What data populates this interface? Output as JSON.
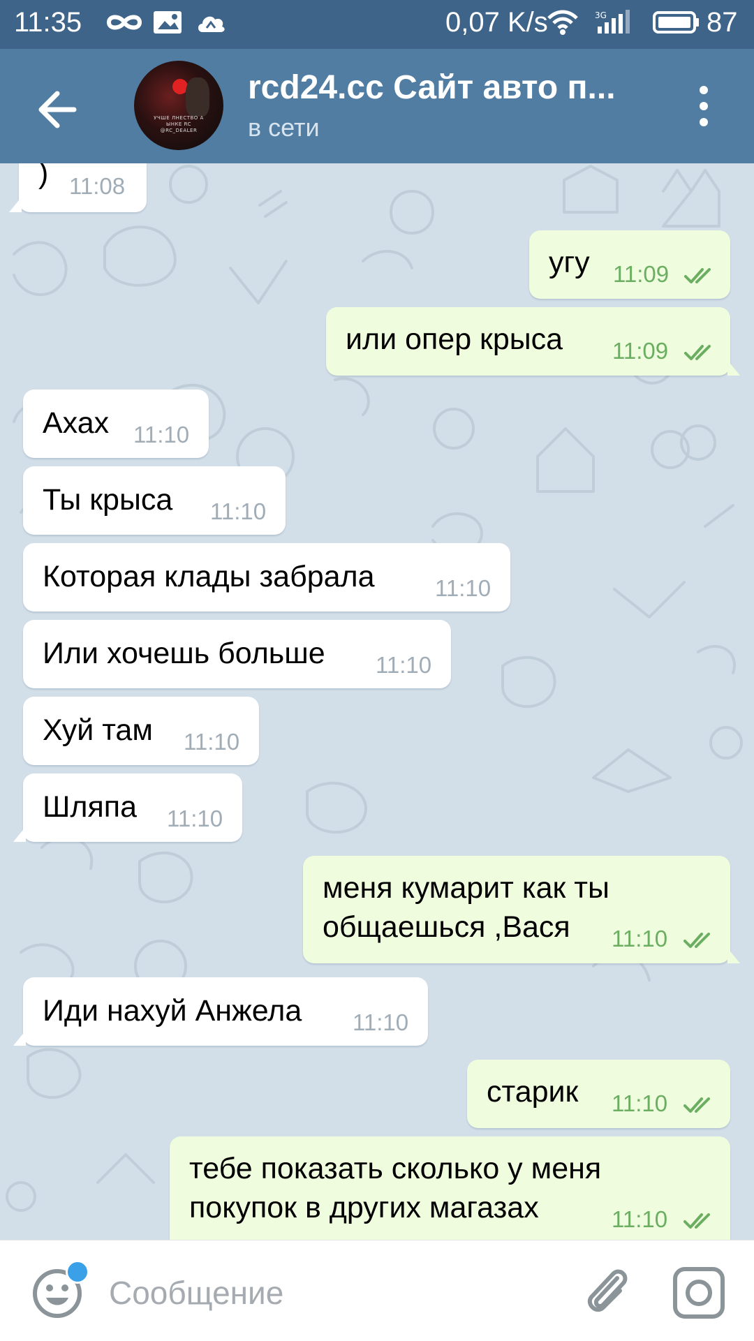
{
  "status_bar": {
    "time": "11:35",
    "speed": "0,07 K/s",
    "battery": "87",
    "icons": [
      "infinity-icon",
      "gallery-icon",
      "cloud-icon",
      "wifi-icon",
      "signal-icon",
      "battery-icon"
    ]
  },
  "header": {
    "title": "rcd24.cc Сайт авто п...",
    "status": "в сети",
    "avatar_caption_1": "УЧШЕ ЛНЕСТВО А ЫНКЕ RC",
    "avatar_caption_2": "@RC_DEALER",
    "icons": [
      "back-arrow-icon",
      "more-vert-icon"
    ]
  },
  "messages": [
    {
      "dir": "in",
      "text": ")",
      "time": "11:08"
    },
    {
      "dir": "out",
      "text": "угу",
      "time": "11:09",
      "read": true
    },
    {
      "dir": "out",
      "text": "или опер крыса",
      "time": "11:09",
      "read": true
    },
    {
      "dir": "in",
      "text": "Ахах",
      "time": "11:10"
    },
    {
      "dir": "in",
      "text": "Ты крыса",
      "time": "11:10"
    },
    {
      "dir": "in",
      "text": "Которая клады забрала",
      "time": "11:10"
    },
    {
      "dir": "in",
      "text": "Или хочешь больше",
      "time": "11:10"
    },
    {
      "dir": "in",
      "text": "Хуй там",
      "time": "11:10"
    },
    {
      "dir": "in",
      "text": "Шляпа",
      "time": "11:10"
    },
    {
      "dir": "out",
      "text": "меня кумарит как ты\nобщаешься ,Вася",
      "time": "11:10",
      "read": true
    },
    {
      "dir": "in",
      "text": "Иди нахуй Анжела",
      "time": "11:10"
    },
    {
      "dir": "out",
      "text": "старик",
      "time": "11:10",
      "read": true
    },
    {
      "dir": "out",
      "text": "тебе показать сколько у меня\nпокупок в других магазах",
      "time": "11:10",
      "read": true
    }
  ],
  "composer": {
    "placeholder": "Сообщение",
    "value": "",
    "icons": [
      "emoji-icon",
      "attach-icon",
      "camera-icon"
    ]
  },
  "colors": {
    "status_bar": "#3f6489",
    "header": "#517da2",
    "chat_bg": "#d3dfe8",
    "bubble_in": "#ffffff",
    "bubble_out": "#effdde",
    "time_in": "#a0acb6",
    "time_out": "#6bae61",
    "notification_dot": "#3aa0e8"
  }
}
